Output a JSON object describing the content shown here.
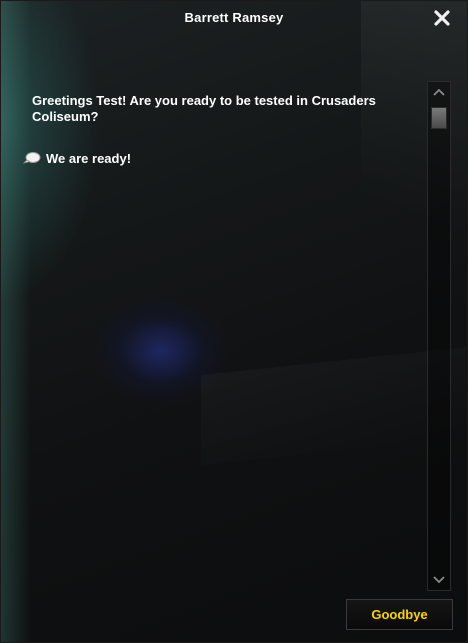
{
  "window": {
    "title": "Barrett Ramsey",
    "close_icon": "close-icon"
  },
  "dialog": {
    "greeting": "Greetings Test! Are you ready to be tested in Crusaders Coliseum?",
    "options": [
      {
        "label": "We are ready!",
        "icon": "chat-bubble-icon"
      }
    ]
  },
  "footer": {
    "goodbye_label": "Goodbye"
  },
  "colors": {
    "title_text": "#ffffff",
    "body_text": "#ffffff",
    "button_text": "#ffd100"
  }
}
